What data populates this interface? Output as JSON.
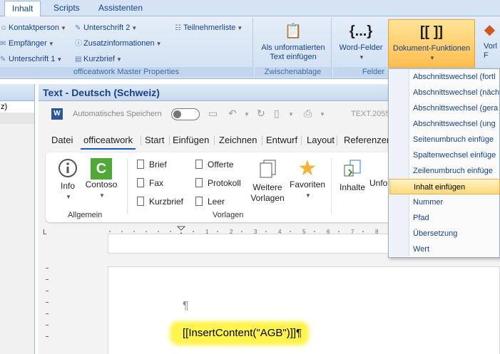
{
  "outer_tabs": [
    "Inhalt",
    "Scripts",
    "Assistenten"
  ],
  "ribbon": {
    "group1": {
      "items": [
        {
          "label": "Kontaktperson",
          "icon": "person-icon"
        },
        {
          "label": "Empfänger",
          "icon": "recipient-icon"
        },
        {
          "label": "Unterschrift 1",
          "icon": "signature-icon"
        },
        {
          "label": "Unterschrift 2",
          "icon": "signature-icon"
        },
        {
          "label": "Zusatzinformationen",
          "icon": "info-icon"
        },
        {
          "label": "Kurzbrief",
          "icon": "note-icon"
        },
        {
          "label": "Teilnehmerliste",
          "icon": "list-icon"
        }
      ],
      "label": "officeatwork Master Properties"
    },
    "paste_button": "Als unformatierten Text einfügen",
    "paste_group": "Zwischenablage",
    "word_fields_button": "Word-Felder",
    "word_fields_group": "Felder",
    "doc_functions_button": "Dokument-Funktionen",
    "next_button": "Vorl F"
  },
  "window_title": "Text - Deutsch (Schweiz)",
  "left_pane": {
    "row1": "z)"
  },
  "qat": {
    "autosave": "Automatisches Speichern",
    "filename": "TEXT.2055"
  },
  "word_tabs": [
    "Datei",
    "officeatwork",
    "Start",
    "Einfügen",
    "Zeichnen",
    "Entwurf",
    "Layout",
    "Referenzen"
  ],
  "word_ribbon": {
    "info": "Info",
    "contoso": "Contoso",
    "allgemein": "Allgemein",
    "vorlagen_items": [
      "Brief",
      "Fax",
      "Kurzbrief",
      "Offerte",
      "Protokoll",
      "Leer"
    ],
    "weitere_vorlagen": "Weitere Vorlagen",
    "favoriten": "Favoriten",
    "vorlagen": "Vorlagen",
    "inhalte": "Inhalte",
    "unfo": "Unfo"
  },
  "document": {
    "para_mark": "¶",
    "field_code": "[[InsertContent(\"AGB\")]]¶"
  },
  "menu": {
    "items": [
      "Abschnittswechsel (fortl",
      "Abschnittswechsel (näch",
      "Abschnittswechsel (gera",
      "Abschnittswechsel (ung",
      "Seitenumbruch einfüge",
      "Spaltenwechsel einfüge",
      "Zeilenumbruch einfüge",
      "Inhalt einfügen",
      "Nummer",
      "Pfad",
      "Übersetzung",
      "Wert"
    ],
    "highlighted_index": 7
  },
  "colors": {
    "accent": "#15428b",
    "highlight": "#fff34d",
    "selected_button": "#ffbd4d"
  }
}
